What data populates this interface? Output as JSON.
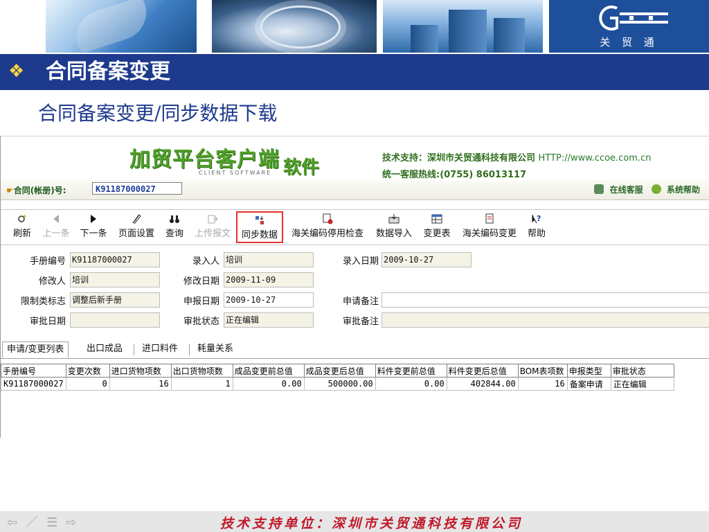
{
  "banner": {
    "logo_text": "关 贸 通"
  },
  "slide": {
    "title": "合同备案变更",
    "subtitle": "合同备案变更/同步数据下载",
    "bullet": "❖"
  },
  "app": {
    "logo_main": "加贸平台客户端",
    "logo_sub": "CLIENT SOFTWARE",
    "logo_soft": "软件",
    "support_label": "技术支持：深圳市关贸通科技有限公司",
    "support_url": "HTTP://www.ccoe.com.cn",
    "hotline": "统一客服热线:(0755) 86013117",
    "contract_label": "合同(帐册)号:",
    "contract_value": "K91187000027",
    "online_service": "在线客服",
    "system_help": "系统帮助"
  },
  "toolbar": {
    "buttons": [
      {
        "label": "刷新",
        "icon": "refresh-icon",
        "disabled": false
      },
      {
        "label": "上一条",
        "icon": "previous-icon",
        "disabled": true
      },
      {
        "label": "下一条",
        "icon": "next-icon",
        "disabled": false
      },
      {
        "label": "页面设置",
        "icon": "page-setup-icon",
        "disabled": false
      },
      {
        "label": "查询",
        "icon": "binoculars-icon",
        "disabled": false
      },
      {
        "label": "上传报文",
        "icon": "upload-icon",
        "disabled": true
      },
      {
        "label": "同步数据",
        "icon": "sync-icon",
        "disabled": false,
        "selected": true
      },
      {
        "label": "海关编码停用检查",
        "icon": "code-check-icon",
        "disabled": false
      },
      {
        "label": "数据导入",
        "icon": "import-icon",
        "disabled": false
      },
      {
        "label": "变更表",
        "icon": "change-table-icon",
        "disabled": false
      },
      {
        "label": "海关编码变更",
        "icon": "code-change-icon",
        "disabled": false
      },
      {
        "label": "帮助",
        "icon": "help-icon",
        "disabled": false
      }
    ]
  },
  "form": {
    "manual_no_label": "手册编号",
    "manual_no": "K91187000027",
    "entry_person_label": "录入人",
    "entry_person": "培训",
    "entry_date_label": "录入日期",
    "entry_date": "2009-10-27",
    "modifier_label": "修改人",
    "modifier": "培训",
    "modify_date_label": "修改日期",
    "modify_date": "2009-11-09",
    "limit_flag_label": "限制类标志",
    "limit_flag": "调整后新手册",
    "declare_date_label": "申报日期",
    "declare_date": "2009-10-27",
    "apply_note_label": "申请备注",
    "apply_note": "",
    "approve_date_label": "审批日期",
    "approve_date": "",
    "approve_status_label": "审批状态",
    "approve_status": "正在编辑",
    "approve_note_label": "审批备注",
    "approve_note": ""
  },
  "tabs": [
    "申请/变更列表",
    "出口成品",
    "进口料件",
    "耗量关系"
  ],
  "grid": {
    "headers": [
      "手册编号",
      "变更次数",
      "进口货物项数",
      "出口货物项数",
      "成品变更前总值",
      "成品变更后总值",
      "料件变更前总值",
      "料件变更后总值",
      "BOM表项数",
      "申报类型",
      "审批状态"
    ],
    "rows": [
      [
        "K91187000027",
        "0",
        "16",
        "1",
        "0.00",
        "500000.00",
        "0.00",
        "402844.00",
        "16",
        "备案申请",
        "正在编辑"
      ]
    ]
  },
  "footer": {
    "text": "技术支持单位：深圳市关贸通科技有限公司"
  }
}
